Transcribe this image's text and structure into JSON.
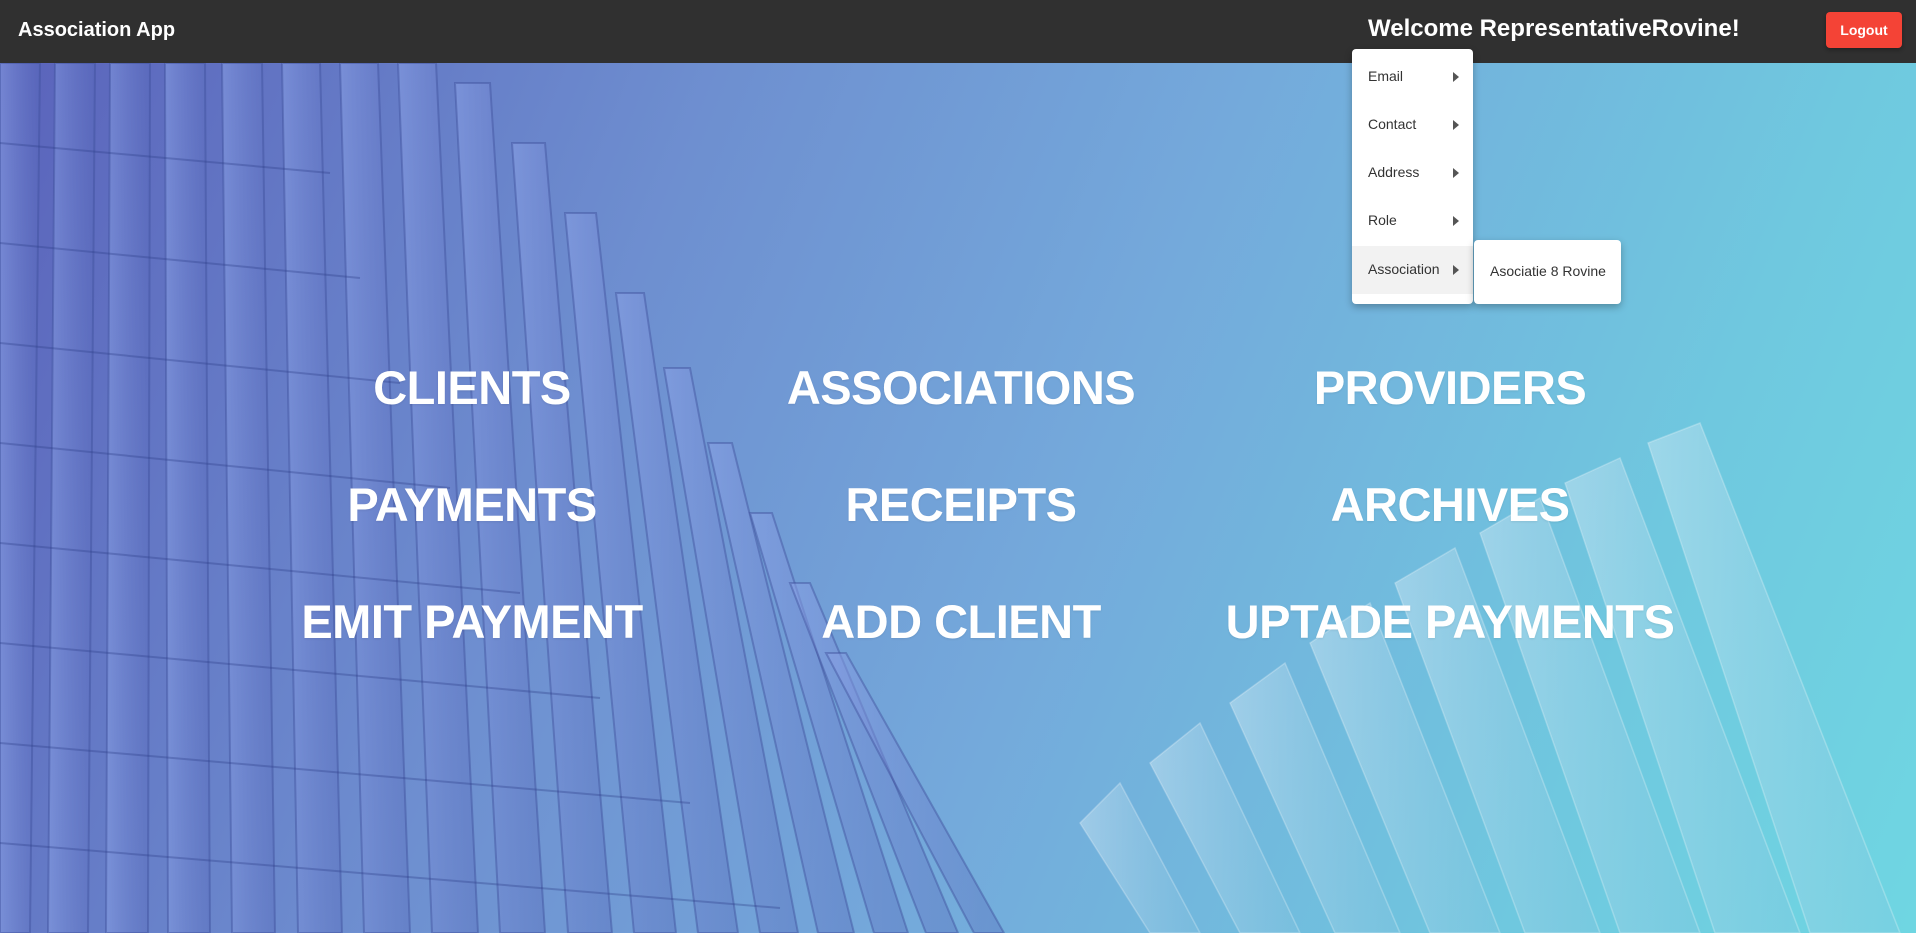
{
  "header": {
    "app_title": "Association App",
    "welcome": "Welcome RepresentativeRovine!",
    "logout_label": "Logout"
  },
  "nav": {
    "clients": "CLIENTS",
    "associations": "ASSOCIATIONS",
    "providers": "PROVIDERS",
    "payments": "PAYMENTS",
    "receipts": "RECEIPTS",
    "archives": "ARCHIVES",
    "emit_payment": "EMIT PAYMENT",
    "add_client": "ADD CLIENT",
    "update_payments": "UPTADE PAYMENTS"
  },
  "menu": {
    "email": "Email",
    "contact": "Contact",
    "address": "Address",
    "role": "Role",
    "association": "Association"
  },
  "submenu": {
    "association_name": "Asociatie 8 Rovine"
  },
  "icons": {
    "submenu_arrow": "caret-right-icon"
  },
  "colors": {
    "topbar": "#303030",
    "logout": "#f44336",
    "text_on_hero": "#ffffff"
  }
}
